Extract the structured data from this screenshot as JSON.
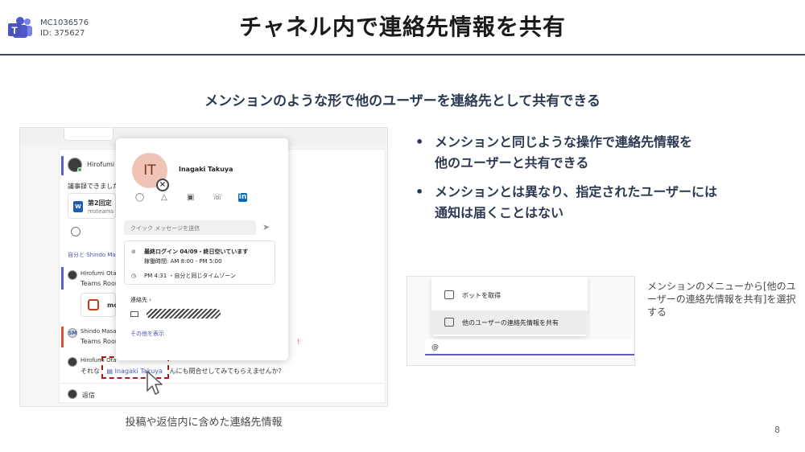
{
  "header": {
    "meta_id": "MC1036576",
    "meta_id2": "ID: 375627",
    "title": "チャネル内で連絡先情報を共有"
  },
  "subtitle": "メンションのような形で他のユーザーを連絡先として共有できる",
  "left_screenshot": {
    "thread": {
      "msg1_author": "Hirofumi O",
      "msg1_text": "議事録できました",
      "file1_name": "第2回定",
      "file1_sub": "msteams",
      "reply_row_label": "自分と Shindo Masa",
      "msg2_author": "Hirofumi Ota",
      "msg2_sub": "Teams Room",
      "file2_name": "mo",
      "msg3_author": "Shindo Masar",
      "msg3_sub": "Teams Room",
      "msg3_badge": "SM",
      "msg4_author": "Hirofumi Ota",
      "msg4_prefix": "それな",
      "msg4_mention": "Inagaki Takuya",
      "msg4_suffix": "んにも問合せしてみてもらえませんか？",
      "reply_label": "返信"
    },
    "card": {
      "initials": "IT",
      "name": "Inagaki Takuya",
      "quick_message_placeholder": "クイック メッセージを送信",
      "status_line1": "最終ログイン 04/09・終日空いています",
      "status_line2": "稼働時間: AM 8:00 - PM 5:00",
      "time_line": "PM 4:31 ・自分と同じタイムゾーン",
      "contact_heading": "連絡先",
      "show_more": "その他を表示"
    }
  },
  "bullets": [
    {
      "line1": "メンションと同じような操作で連絡先情報を",
      "line2": "他のユーザーと共有できる"
    },
    {
      "line1": "メンションとは異なり、指定されたユーザーには",
      "line2": "通知は届くことはない"
    }
  ],
  "right_screenshot": {
    "menu_items": [
      {
        "label": "ボットを取得",
        "icon": "bot-icon"
      },
      {
        "label": "他のユーザーの連絡先情報を共有",
        "icon": "contact-card-icon"
      }
    ],
    "compose_value": "@"
  },
  "caption_right": "メンションのメニューから[他のユーザーの連絡先情報を共有]を選択する",
  "caption_left": "投稿や返信内に含めた連絡先情報",
  "page_number": "8",
  "colors": {
    "teams_purple": "#5b5fc7",
    "heading_navy": "#2b3a52",
    "highlight_red": "#a81d1d",
    "avatar_peach": "#efc3b6"
  }
}
